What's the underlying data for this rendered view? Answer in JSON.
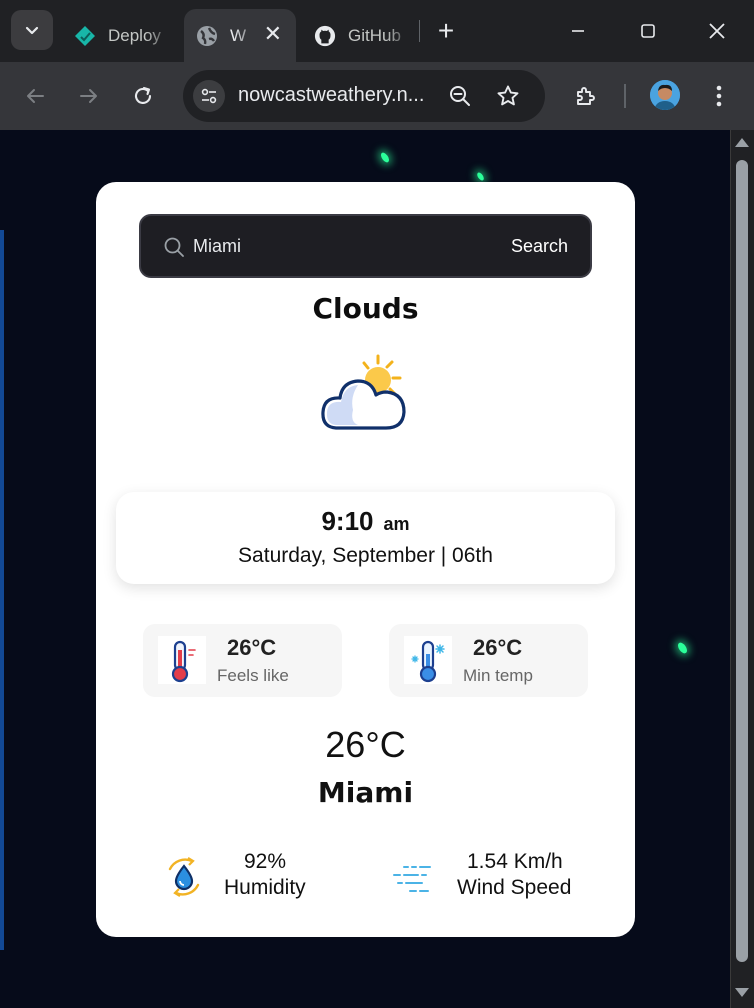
{
  "browser": {
    "tabs": [
      {
        "title": "Deploy",
        "favicon": "netlify-diamond-icon"
      },
      {
        "title": "W",
        "favicon": "globe-icon",
        "active": true
      },
      {
        "title": "GitHub",
        "favicon": "github-icon"
      }
    ],
    "url": "nowcastweathery.n...",
    "accent": "#35363a"
  },
  "search": {
    "value": "Miami",
    "button": "Search"
  },
  "weather": {
    "condition": "Clouds",
    "condition_icon": "cloud-sun-icon",
    "time": "9:10",
    "ampm": "am",
    "date": "Saturday, September | 06th",
    "feels_like": {
      "value": "26°C",
      "label": "Feels like"
    },
    "min_temp": {
      "value": "26°C",
      "label": "Min temp"
    },
    "temperature": "26°C",
    "city": "Miami",
    "humidity": {
      "value": "92%",
      "label": "Humidity"
    },
    "wind": {
      "value": "1.54 Km/h",
      "label": "Wind Speed"
    }
  }
}
